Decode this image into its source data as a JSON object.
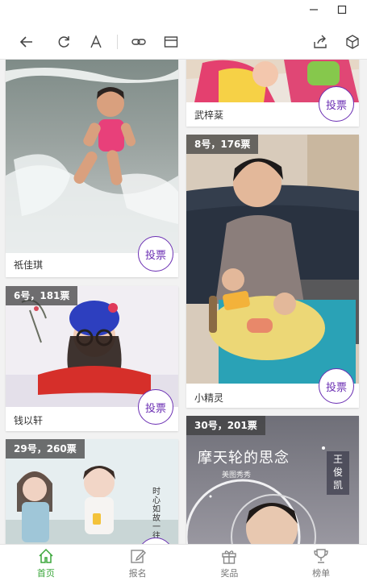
{
  "window": {
    "minimize_icon": "minimize-icon",
    "maximize_icon": "maximize-icon"
  },
  "toolbar": {
    "icons": [
      "back-icon",
      "refresh-icon",
      "font-size-icon",
      "link-icon",
      "window-icon",
      "share-icon",
      "cube-icon"
    ]
  },
  "cards": [
    {
      "name": "",
      "badge": "",
      "vote_label": "",
      "partial": true
    },
    {
      "name": "武梓棻",
      "badge": "",
      "vote_label": "投票"
    },
    {
      "name": "祇佳琪",
      "badge": "",
      "vote_label": "投票"
    },
    {
      "name": "小精灵",
      "badge": "8号，176票",
      "vote_label": "投票"
    },
    {
      "name": "钱以轩",
      "badge": "6号，181票",
      "vote_label": "投票"
    },
    {
      "name": "",
      "badge": "29号，260票",
      "vote_label": ""
    },
    {
      "name": "",
      "badge": "30号，201票",
      "vote_label": ""
    }
  ],
  "photo_text": {
    "ferris_title": "摩天轮的思念",
    "ferris_sub": "美图秀秀",
    "ferris_name": "王俊凯",
    "card6_poem": "时心如故一往情深"
  },
  "tabs": [
    {
      "label": "首页",
      "icon": "home-icon",
      "active": true
    },
    {
      "label": "报名",
      "icon": "edit-icon",
      "active": false
    },
    {
      "label": "奖品",
      "icon": "gift-icon",
      "active": false
    },
    {
      "label": "榜单",
      "icon": "trophy-icon",
      "active": false
    }
  ],
  "colors": {
    "accent": "#6b2fb3",
    "tab_active": "#3aa63a"
  }
}
